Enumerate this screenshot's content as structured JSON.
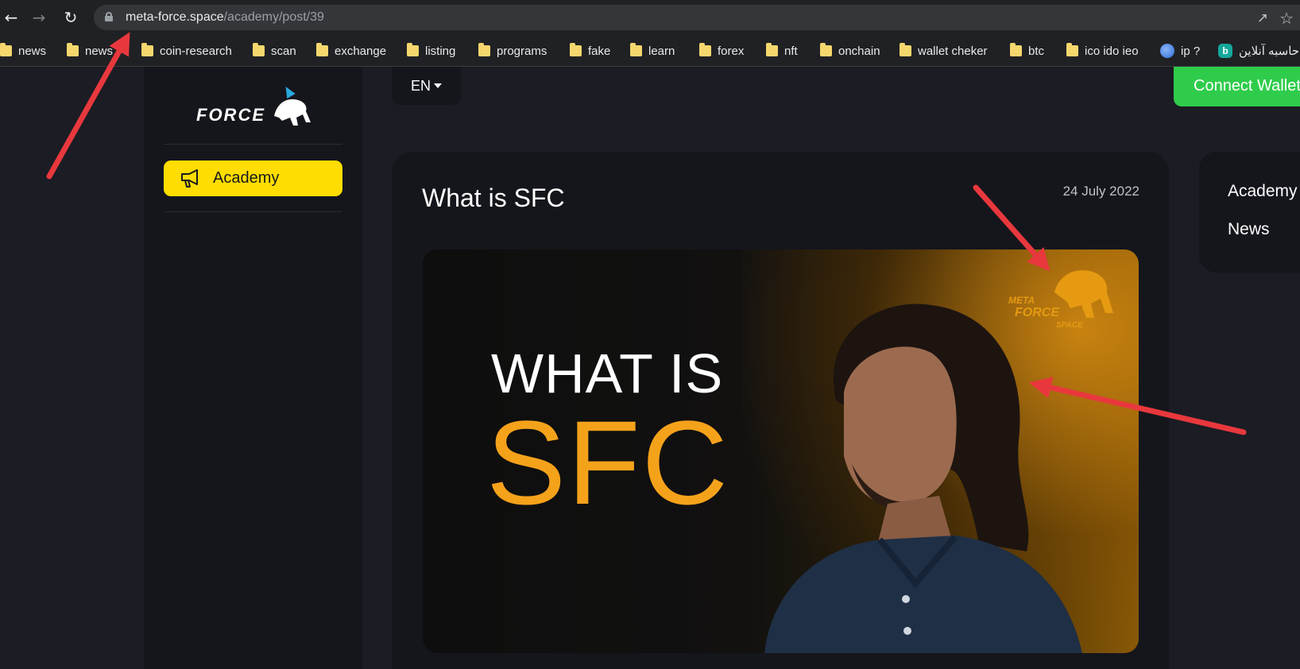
{
  "browser": {
    "url_host": "meta-force.space",
    "url_path": "/academy/post/39",
    "bookmarks": [
      {
        "label": "news",
        "icon": "folder-icon"
      },
      {
        "label": "news",
        "icon": "folder-icon"
      },
      {
        "label": "coin-research",
        "icon": "folder-icon"
      },
      {
        "label": "scan",
        "icon": "folder-icon"
      },
      {
        "label": "exchange",
        "icon": "folder-icon"
      },
      {
        "label": "listing",
        "icon": "folder-icon"
      },
      {
        "label": "programs",
        "icon": "folder-icon"
      },
      {
        "label": "fake",
        "icon": "folder-icon"
      },
      {
        "label": "learn",
        "icon": "folder-icon"
      },
      {
        "label": "forex",
        "icon": "folder-icon"
      },
      {
        "label": "nft",
        "icon": "folder-icon"
      },
      {
        "label": "onchain",
        "icon": "folder-icon"
      },
      {
        "label": "wallet cheker",
        "icon": "folder-icon"
      },
      {
        "label": "btc",
        "icon": "folder-icon"
      },
      {
        "label": "ico ido ieo",
        "icon": "folder-icon"
      },
      {
        "label": "ip ?",
        "icon": "globe-icon"
      },
      {
        "label": "حاسبه آنلاین",
        "icon": "bale-icon"
      }
    ]
  },
  "sidebar": {
    "logo_text": "FORCE",
    "academy_label": "Academy"
  },
  "header": {
    "language": "EN",
    "connect_label": "Connect Wallet"
  },
  "post": {
    "title": "What is SFC",
    "date": "24 July 2022",
    "hero_line1": "WHAT IS",
    "hero_line2": "SFC",
    "hero_logo_meta": "META",
    "hero_logo_force": "FORCE",
    "hero_logo_space": "SPACE"
  },
  "right_menu": {
    "items": [
      "Academy",
      "News"
    ]
  },
  "colors": {
    "accent_yellow": "#ffdd00",
    "connect_green": "#2fcc4b",
    "sfc_orange": "#f5a21b",
    "annotation_red": "#e8383d"
  }
}
